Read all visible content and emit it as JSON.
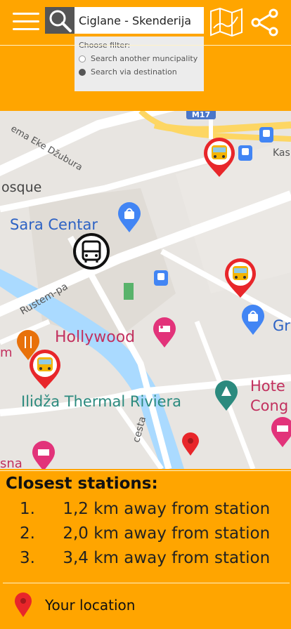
{
  "header": {
    "search": {
      "value": "Ciglane - Skenderija",
      "placeholder": ""
    },
    "filter": {
      "title": "Choose filter:",
      "options": [
        {
          "label": "Search another muncipality",
          "checked": false
        },
        {
          "label": "Search via destination",
          "checked": true
        }
      ]
    }
  },
  "map": {
    "road_shield": "M17",
    "labels": {
      "street_top": "ema Eke Džubura",
      "mosque": "osque",
      "sara_centar": "Sara Centar",
      "rustem": "Rustem-pa",
      "hollywood": "Hollywood",
      "ilidza": "Ilidža Thermal Riviera",
      "hotel": "Hote",
      "cong": "Cong",
      "gr": "Gr",
      "kas": "Kas",
      "cesta": "cesta",
      "sna": "sna",
      "m_left": "m"
    },
    "colors": {
      "accent": "#ffa500",
      "pin_red": "#e8262a",
      "poi_blue": "#4285f4",
      "poi_pink": "#e2337a"
    }
  },
  "stations": {
    "title": "Closest stations:",
    "items": [
      {
        "num": "1.",
        "text": "1,2 km away from station"
      },
      {
        "num": "2.",
        "text": "2,0 km away from station"
      },
      {
        "num": "3.",
        "text": "3,4 km away from station"
      }
    ]
  },
  "legend": {
    "label": "Your location"
  }
}
